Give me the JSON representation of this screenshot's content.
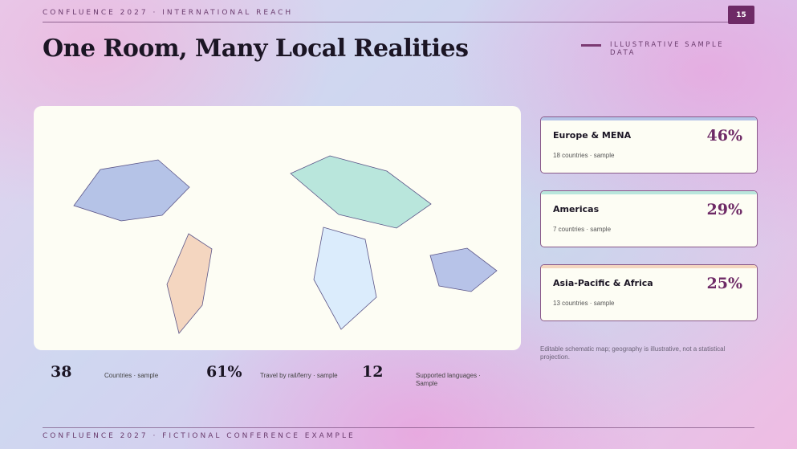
{
  "header": {
    "kicker": "CONFLUENCE 2027 · INTERNATIONAL REACH",
    "page_number": "15",
    "title": "One Room, Many Local Realities",
    "tag": "ILLUSTRATIVE SAMPLE DATA"
  },
  "map": {
    "region_colors": {
      "blue": "#b5c3e7",
      "peach": "#f4d6c0",
      "green": "#b9e6dc",
      "lightblue": "#dbecfc",
      "periwinkle": "#b7c3e8"
    }
  },
  "regions": [
    {
      "name": "Europe & MENA",
      "sub": "18 countries · sample",
      "pct": "46%",
      "accent": "#b5c3e7"
    },
    {
      "name": "Americas",
      "sub": "7 countries · sample",
      "pct": "29%",
      "accent": "#b9e6dc"
    },
    {
      "name": "Asia-Pacific & Africa",
      "sub": "13 countries · sample",
      "pct": "25%",
      "accent": "#f4d6c0"
    }
  ],
  "note": "Editable schematic map; geography is illustrative, not a statistical projection.",
  "stats": [
    {
      "value": "38",
      "label": "Countries · sample"
    },
    {
      "value": "61%",
      "label": "Travel by rail/ferry · sample"
    },
    {
      "value": "12",
      "label": "Supported languages · Sample"
    }
  ],
  "footer": "CONFLUENCE 2027 · FICTIONAL CONFERENCE EXAMPLE"
}
